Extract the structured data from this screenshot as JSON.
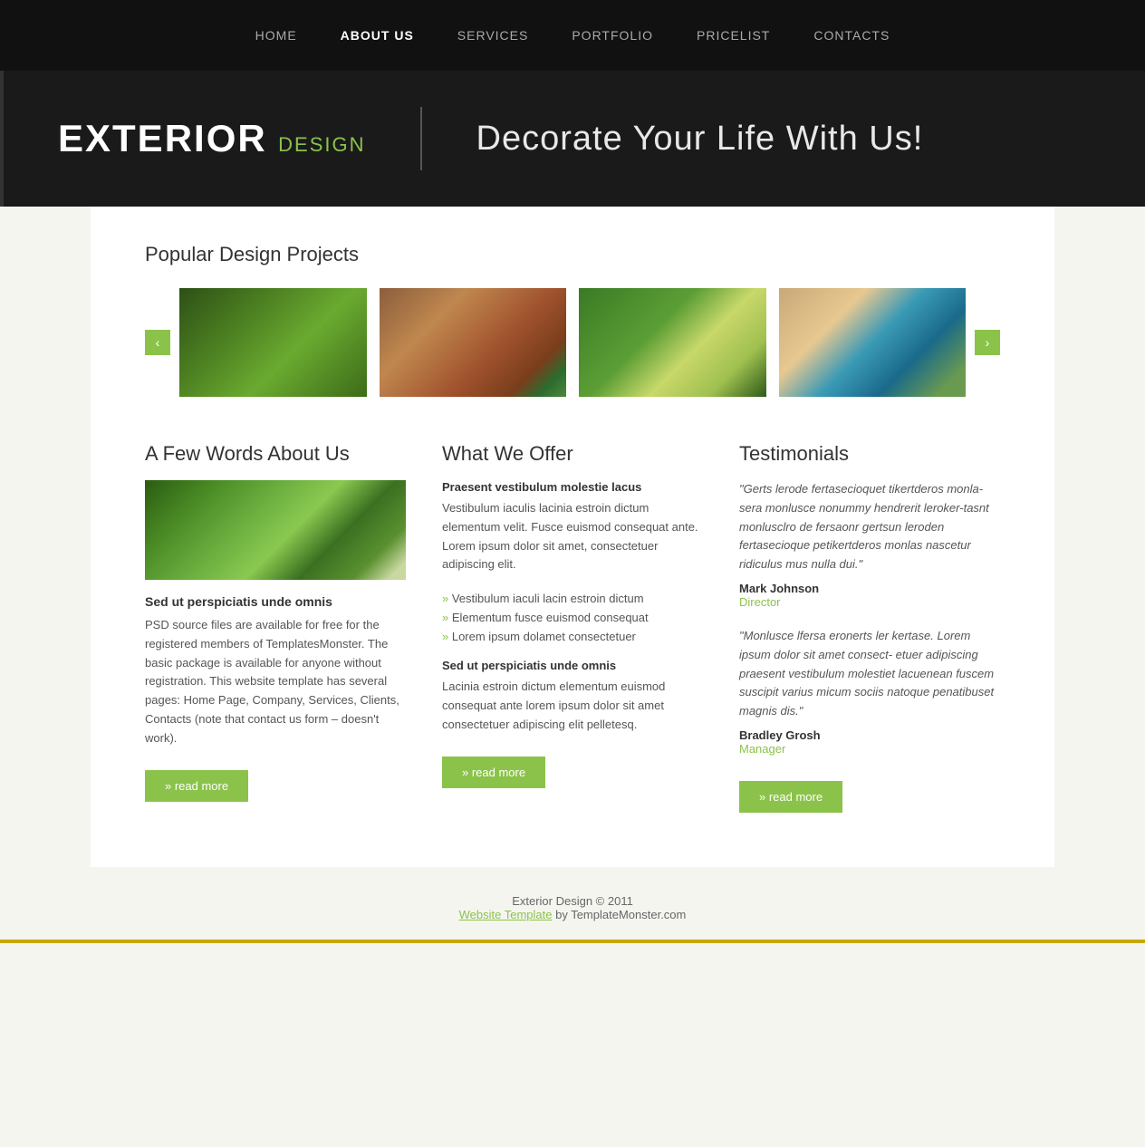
{
  "nav": {
    "items": [
      {
        "label": "HOME",
        "active": false,
        "id": "home"
      },
      {
        "label": "ABOUT US",
        "active": true,
        "id": "about"
      },
      {
        "label": "SERVICES",
        "active": false,
        "id": "services"
      },
      {
        "label": "PORTFOLIO",
        "active": false,
        "id": "portfolio"
      },
      {
        "label": "PRICELIST",
        "active": false,
        "id": "pricelist"
      },
      {
        "label": "CONTACTS",
        "active": false,
        "id": "contacts"
      }
    ]
  },
  "hero": {
    "brand_main": "EXTERIOR",
    "brand_sub": "DESIGN",
    "tagline": "Decorate Your Life With Us!"
  },
  "projects": {
    "title": "Popular Design Projects",
    "prev_label": "‹",
    "next_label": "›"
  },
  "about": {
    "title": "A Few Words About Us",
    "subtitle": "Sed ut perspiciatis unde omnis",
    "body": "PSD source files are available for free for the registered members of TemplatesMonster. The basic package is available for anyone without registration. This website template has several pages: Home Page, Company, Services, Clients, Contacts (note that contact us form – doesn't work).",
    "read_more": "» read more"
  },
  "offer": {
    "title": "What We Offer",
    "intro_bold": "Praesent vestibulum molestie lacus",
    "intro_text": "Vestibulum iaculis lacinia estroin dictum elementum velit. Fusce euismod consequat ante. Lorem ipsum dolor sit amet, consectetuer adipiscing elit.",
    "list_items": [
      "Vestibulum iaculi lacin estroin dictum",
      "Elementum fusce euismod consequat",
      "Lorem ipsum dolamet consectetuer"
    ],
    "section2_title": "Sed ut perspiciatis unde omnis",
    "section2_text": "Lacinia estroin dictum elementum euismod consequat ante lorem ipsum dolor sit amet consectetuer adipiscing elit pelletesq.",
    "read_more": "» read more"
  },
  "testimonials": {
    "title": "Testimonials",
    "items": [
      {
        "quote": "\"Gerts lerode fertasecioquet tikertderos monla-sera monlusce nonummy hendrerit leroker-tasnt monlusclro de fersaonr gertsun leroden fertasecioque petikertderos monlas nascetur ridiculus mus nulla dui.\"",
        "name": "Mark Johnson",
        "role": "Director"
      },
      {
        "quote": "\"Monlusce lfersa eronerts ler kertase. Lorem ipsum dolor sit amet consect- etuer adipiscing praesent vestibulum molestiet lacuenean fuscem suscipit varius micum sociis natoque penatibuset magnis dis.\"",
        "name": "Bradley Grosh",
        "role": "Manager"
      }
    ],
    "read_more": "» read more"
  },
  "footer": {
    "copyright": "Exterior Design © 2011",
    "link_text": "Website Template",
    "link_suffix": " by TemplateMonster.com"
  }
}
